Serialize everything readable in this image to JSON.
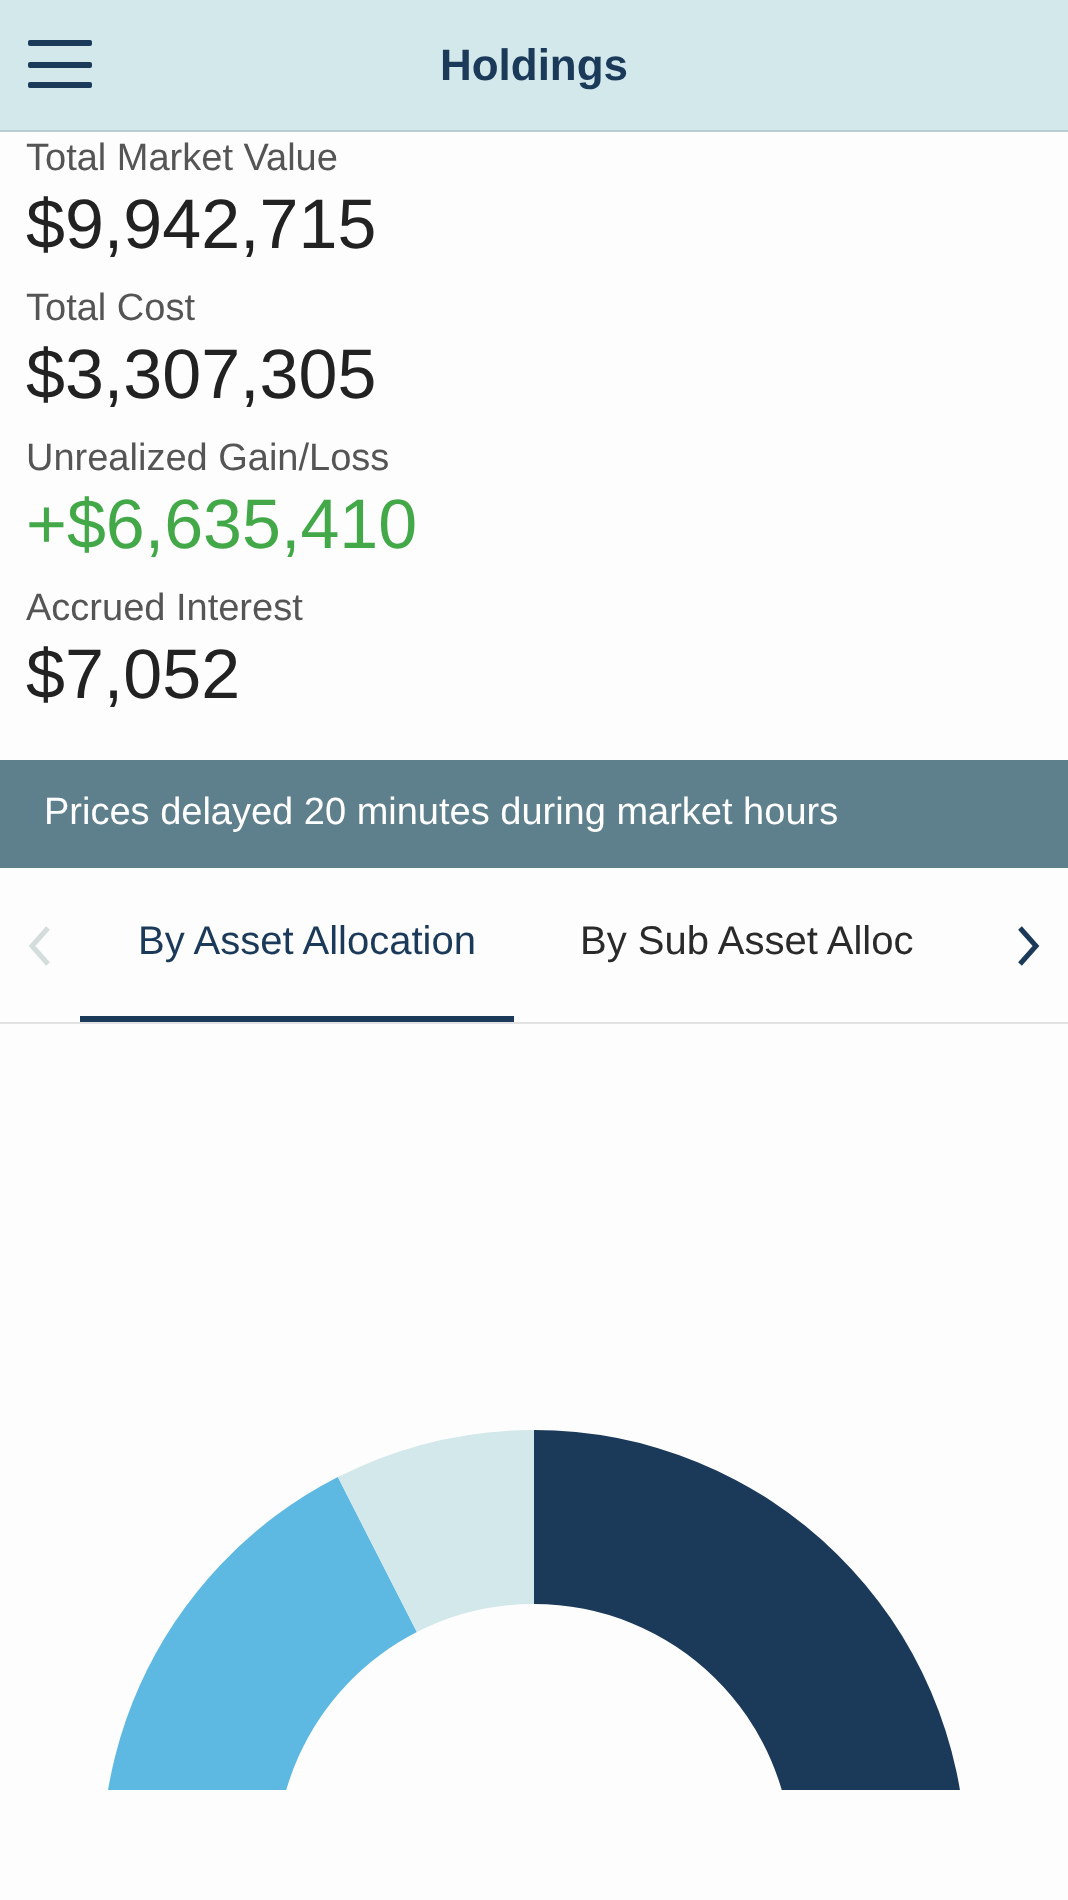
{
  "header": {
    "title": "Holdings"
  },
  "summary": [
    {
      "label": "Total Market Value",
      "value": "$9,942,715",
      "kind": "neutral"
    },
    {
      "label": "Total Cost",
      "value": "$3,307,305",
      "kind": "neutral"
    },
    {
      "label": "Unrealized Gain/Loss",
      "value": "+$6,635,410",
      "kind": "gain"
    },
    {
      "label": "Accrued Interest",
      "value": "$7,052",
      "kind": "neutral"
    }
  ],
  "notice": "Prices delayed 20 minutes during market hours",
  "tabs": {
    "prev_disabled": true,
    "next_disabled": false,
    "items": [
      {
        "label": "By Asset Allocation",
        "selected": true
      },
      {
        "label": "By Sub Asset Alloc",
        "selected": false
      }
    ]
  }
}
